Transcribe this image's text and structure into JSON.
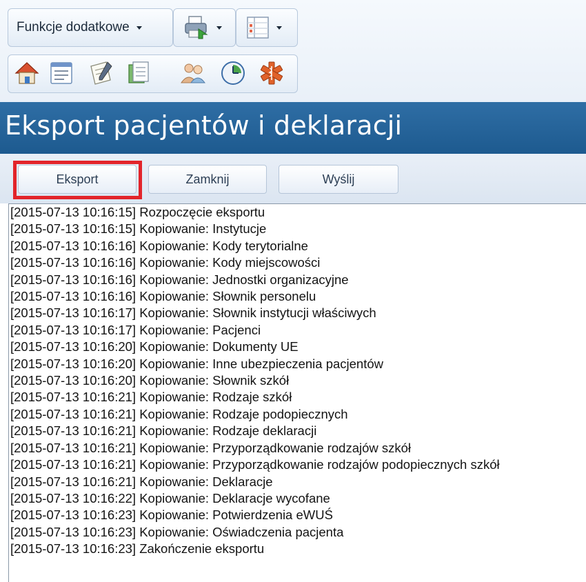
{
  "toolbar": {
    "functions_label": "Funkcje dodatkowe",
    "icons": [
      "home-icon",
      "calendar-list-icon",
      "notes-icon",
      "documents-icon",
      "users-icon",
      "clock-icon",
      "medical-star-icon"
    ]
  },
  "header": {
    "title": "Eksport pacjentów i deklaracji"
  },
  "buttons": {
    "export_label": "Eksport",
    "close_label": "Zamknij",
    "send_label": "Wyślij"
  },
  "log": [
    "[2015-07-13 10:16:15] Rozpoczęcie eksportu",
    "[2015-07-13 10:16:15] Kopiowanie: Instytucje",
    "[2015-07-13 10:16:16] Kopiowanie: Kody terytorialne",
    "[2015-07-13 10:16:16] Kopiowanie: Kody miejscowości",
    "[2015-07-13 10:16:16] Kopiowanie: Jednostki organizacyjne",
    "[2015-07-13 10:16:16] Kopiowanie: Słownik personelu",
    "[2015-07-13 10:16:17] Kopiowanie: Słownik instytucji właściwych",
    "[2015-07-13 10:16:17] Kopiowanie: Pacjenci",
    "[2015-07-13 10:16:20] Kopiowanie: Dokumenty UE",
    "[2015-07-13 10:16:20] Kopiowanie: Inne ubezpieczenia pacjentów",
    "[2015-07-13 10:16:20] Kopiowanie: Słownik szkół",
    "[2015-07-13 10:16:21] Kopiowanie: Rodzaje szkół",
    "[2015-07-13 10:16:21] Kopiowanie: Rodzaje podopiecznych",
    "[2015-07-13 10:16:21] Kopiowanie: Rodzaje deklaracji",
    "[2015-07-13 10:16:21] Kopiowanie: Przyporządkowanie rodzajów szkół",
    "[2015-07-13 10:16:21] Kopiowanie: Przyporządkowanie rodzajów podopiecznych szkół",
    "[2015-07-13 10:16:21] Kopiowanie: Deklaracje",
    "[2015-07-13 10:16:22] Kopiowanie: Deklaracje wycofane",
    "[2015-07-13 10:16:23] Kopiowanie: Potwierdzenia eWUŚ",
    "[2015-07-13 10:16:23] Kopiowanie: Oświadczenia pacjenta",
    "[2015-07-13 10:16:23] Zakończenie eksportu"
  ],
  "colors": {
    "header_bg": "#24639a",
    "highlight": "#e2242a"
  }
}
